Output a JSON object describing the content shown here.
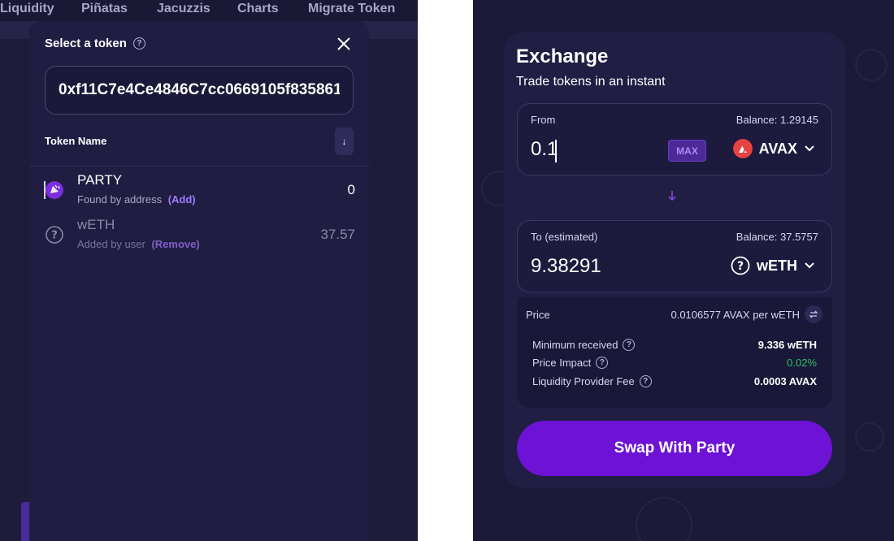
{
  "nav": {
    "items": [
      {
        "label": "Liquidity"
      },
      {
        "label": "Piñatas"
      },
      {
        "label": "Jacuzzis"
      },
      {
        "label": "Charts"
      },
      {
        "label": "Migrate Token"
      }
    ]
  },
  "token_modal": {
    "title": "Select a token",
    "search_value": "0xf11C7e4Ce4846C7cc0669105f835861",
    "column_header": "Token Name",
    "sort_glyph": "↓",
    "tokens": [
      {
        "name": "PARTY",
        "source": "Found by address",
        "action": "(Add)",
        "balance": "0"
      },
      {
        "name": "wETH",
        "source": "Added by user",
        "action": "(Remove)",
        "balance": "37.57"
      }
    ]
  },
  "exchange": {
    "title": "Exchange",
    "subtitle": "Trade tokens in an instant",
    "from": {
      "label": "From",
      "balance": "Balance: 1.29145",
      "amount": "0.1",
      "max_label": "MAX",
      "currency": "AVAX"
    },
    "to": {
      "label": "To (estimated)",
      "balance": "Balance: 37.5757",
      "amount": "9.38291",
      "currency": "wETH"
    },
    "price_label": "Price",
    "price_value": "0.0106577 AVAX per wETH",
    "details": [
      {
        "label": "Minimum received",
        "value": "9.336 wETH"
      },
      {
        "label": "Price Impact",
        "value": "0.02%"
      },
      {
        "label": "Liquidity Provider Fee",
        "value": "0.0003 AVAX"
      }
    ],
    "swap_label": "Swap With Party"
  },
  "colors": {
    "accent": "#6e12d6",
    "link": "#9e7bff",
    "positive": "#26c26a",
    "avax": "#e84142"
  }
}
